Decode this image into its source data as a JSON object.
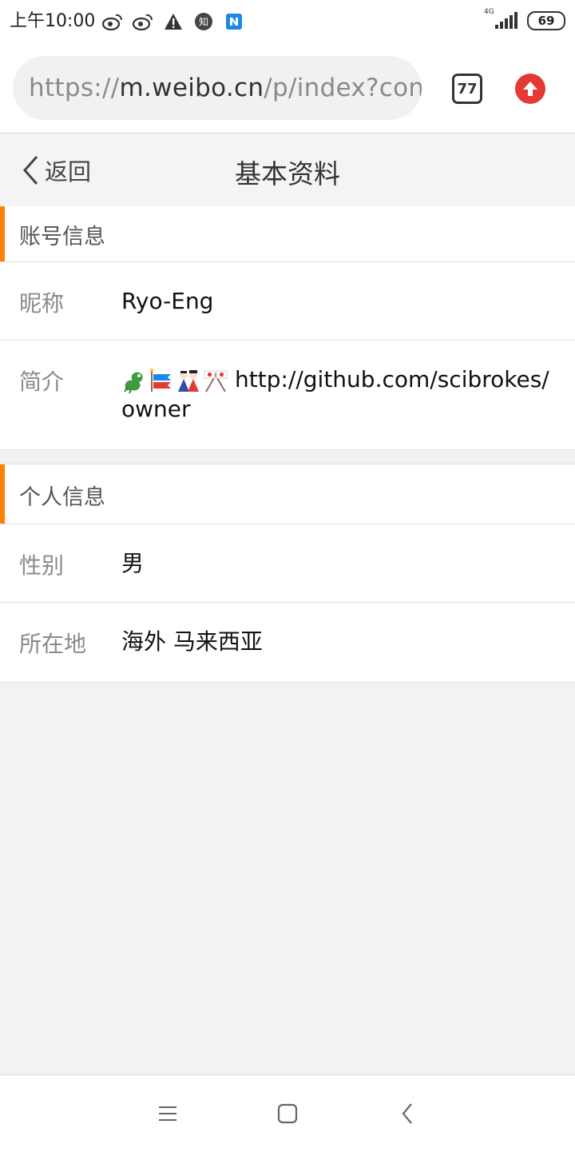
{
  "status_bar": {
    "time": "上午10:00",
    "network": "4G",
    "battery": "69",
    "notif_icons": [
      "weibo-icon",
      "weibo-icon",
      "warning-icon",
      "zhihu-icon",
      "app-n-icon"
    ],
    "zhihu_glyph": "知"
  },
  "browser": {
    "url_scheme": "https://",
    "url_host": "m.weibo.cn",
    "url_path": "/p/index?contai",
    "tab_count": "77",
    "accent_color": "#e53935"
  },
  "header": {
    "back_label": "返回",
    "title": "基本资料"
  },
  "sections": {
    "account": {
      "title": "账号信息",
      "nickname_label": "昵称",
      "nickname_value": "Ryo-Eng",
      "bio_label": "简介",
      "bio_emojis": [
        "dragon-emoji",
        "carp-streamer-emoji",
        "dolls-emoji",
        "crossed-flags-emoji"
      ],
      "bio_line1": "http://github.com/scibrokes/",
      "bio_line2": "owner"
    },
    "personal": {
      "title": "个人信息",
      "gender_label": "性别",
      "gender_value": "男",
      "location_label": "所在地",
      "location_value": "海外 马来西亚"
    }
  },
  "accent_color": "#ff8200",
  "nav": {
    "icons": [
      "menu-icon",
      "home-square-icon",
      "back-chevron-icon"
    ]
  }
}
